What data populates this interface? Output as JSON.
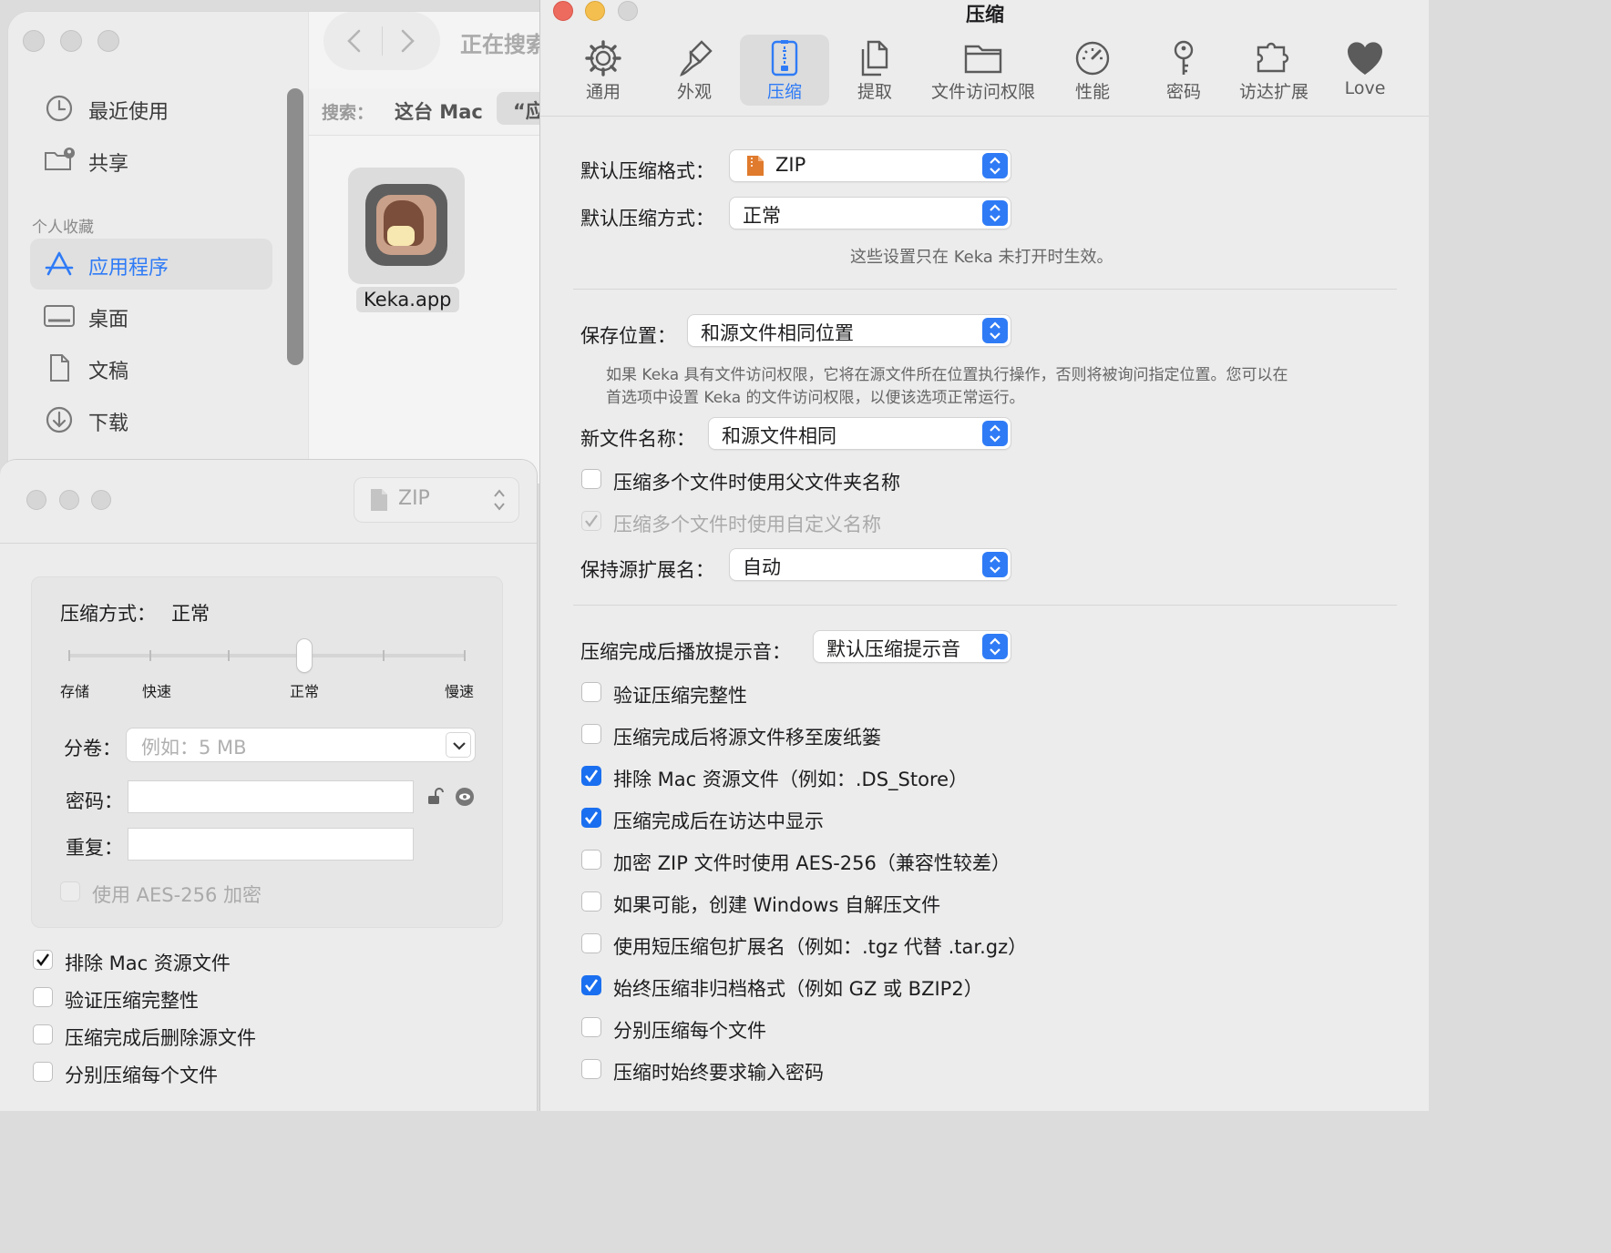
{
  "finder": {
    "title": "正在搜索",
    "sidebar": {
      "items": [
        {
          "label": "最近使用",
          "icon": "clock-icon"
        },
        {
          "label": "共享",
          "icon": "shared-folder-icon"
        }
      ],
      "section_title": "个人收藏",
      "favorites": [
        {
          "label": "应用程序",
          "icon": "apps-icon"
        },
        {
          "label": "桌面",
          "icon": "desktop-icon"
        },
        {
          "label": "文稿",
          "icon": "document-icon"
        },
        {
          "label": "下载",
          "icon": "download-icon"
        }
      ]
    },
    "search_scope_label": "搜索：",
    "scope_this_mac": "这台 Mac",
    "scope_chip": "“应",
    "file": {
      "name": "Keka.app"
    }
  },
  "panel": {
    "format": "ZIP",
    "method_label": "压缩方式：",
    "method_value": "正常",
    "slider": {
      "ticks": [
        "存储",
        "快速",
        "正常",
        "慢速"
      ],
      "level_fraction": 0.6
    },
    "split_label": "分卷：",
    "split_placeholder": "例如：5 MB",
    "password_label": "密码：",
    "repeat_label": "重复：",
    "aes_label": "使用 AES-256 加密",
    "checks": [
      {
        "label": "排除 Mac 资源文件",
        "checked": true
      },
      {
        "label": "验证压缩完整性",
        "checked": false
      },
      {
        "label": "压缩完成后删除源文件",
        "checked": false
      },
      {
        "label": "分别压缩每个文件",
        "checked": false
      }
    ]
  },
  "prefs": {
    "title": "压缩",
    "tabs": [
      {
        "label": "通用",
        "icon": "gear-icon"
      },
      {
        "label": "外观",
        "icon": "brush-icon"
      },
      {
        "label": "压缩",
        "icon": "zip-icon"
      },
      {
        "label": "提取",
        "icon": "extract-icon"
      },
      {
        "label": "文件访问权限",
        "icon": "folder-icon"
      },
      {
        "label": "性能",
        "icon": "gauge-icon"
      },
      {
        "label": "密码",
        "icon": "key-icon"
      },
      {
        "label": "访达扩展",
        "icon": "puzzle-icon"
      },
      {
        "label": "Love",
        "icon": "heart-icon"
      }
    ],
    "default_format_label": "默认压缩格式：",
    "default_format_value": "ZIP",
    "default_method_label": "默认压缩方式：",
    "default_method_value": "正常",
    "settings_note": "这些设置只在 Keka 未打开时生效。",
    "save_location_label": "保存位置：",
    "save_location_value": "和源文件相同位置",
    "save_location_note_1": "如果 Keka 具有文件访问权限，它将在源文件所在位置执行操作，否则将被询问指定位置。您可以在",
    "save_location_note_2": "首选项中设置 Keka 的文件访问权限，以便该选项正常运行。",
    "new_name_label": "新文件名称：",
    "new_name_value": "和源文件相同",
    "use_parent_name": "压缩多个文件时使用父文件夹名称",
    "use_custom_name": "压缩多个文件时使用自定义名称",
    "keep_ext_label": "保持源扩展名：",
    "keep_ext_value": "自动",
    "sound_label": "压缩完成后播放提示音：",
    "sound_value": "默认压缩提示音",
    "options": [
      {
        "label": "验证压缩完整性",
        "checked": false
      },
      {
        "label": "压缩完成后将源文件移至废纸篓",
        "checked": false
      },
      {
        "label": "排除 Mac 资源文件（例如：.DS_Store）",
        "checked": true
      },
      {
        "label": "压缩完成后在访达中显示",
        "checked": true
      },
      {
        "label": "加密 ZIP 文件时使用 AES-256（兼容性较差）",
        "checked": false
      },
      {
        "label": "如果可能，创建 Windows 自解压文件",
        "checked": false
      },
      {
        "label": "使用短压缩包扩展名（例如：.tgz 代替 .tar.gz）",
        "checked": false
      },
      {
        "label": "始终压缩非归档格式（例如 GZ 或 BZIP2）",
        "checked": true
      },
      {
        "label": "分别压缩每个文件",
        "checked": false
      },
      {
        "label": "压缩时始终要求输入密码",
        "checked": false
      }
    ]
  },
  "colors": {
    "accent": "#2f7bf6",
    "close": "#ed6a5e",
    "minimize": "#f5bf4f",
    "zip_icon": "#e07a2c"
  }
}
